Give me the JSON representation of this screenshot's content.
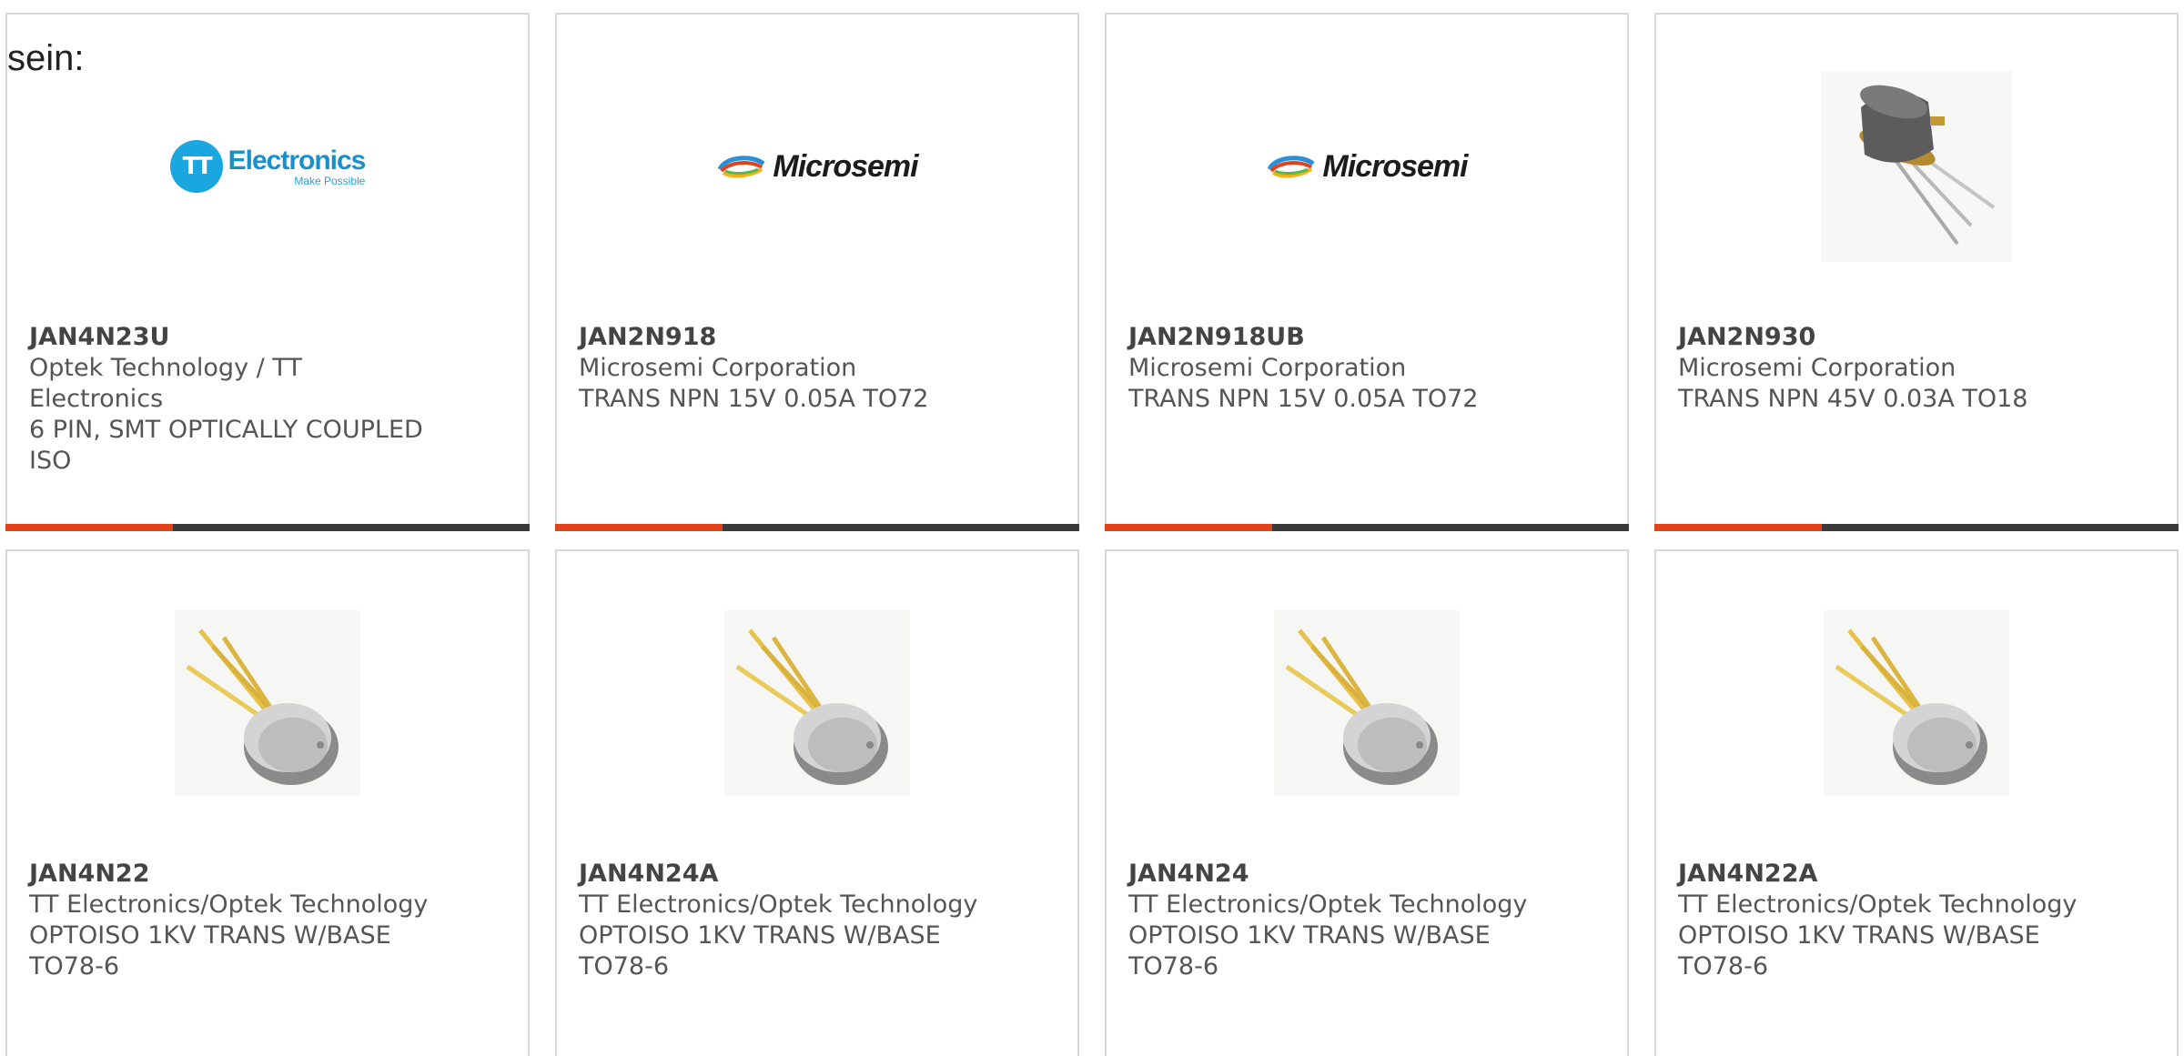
{
  "intro": {
    "text": "sein:"
  },
  "colors": {
    "accent": "#e2431a",
    "bar": "#3a3a3a",
    "border": "#d9d9d9",
    "text": "#555555"
  },
  "products": [
    {
      "part": "JAN4N23U",
      "manufacturer": "Optek Technology / TT Electronics",
      "description": "6 PIN, SMT OPTICALLY COUPLED ISO",
      "image": "tt-electronics-logo"
    },
    {
      "part": "JAN2N918",
      "manufacturer": "Microsemi Corporation",
      "description": "TRANS NPN 15V 0.05A TO72",
      "image": "microsemi-logo"
    },
    {
      "part": "JAN2N918UB",
      "manufacturer": "Microsemi Corporation",
      "description": "TRANS NPN 15V 0.05A TO72",
      "image": "microsemi-logo"
    },
    {
      "part": "JAN2N930",
      "manufacturer": "Microsemi Corporation",
      "description": "TRANS NPN 45V 0.03A TO18",
      "image": "to18-transistor-photo"
    },
    {
      "part": "JAN4N22",
      "manufacturer": "TT Electronics/Optek Technology",
      "description": "OPTOISO 1KV TRANS W/BASE TO78-6",
      "image": "to78-optoisolator-photo"
    },
    {
      "part": "JAN4N24A",
      "manufacturer": "TT Electronics/Optek Technology",
      "description": "OPTOISO 1KV TRANS W/BASE TO78-6",
      "image": "to78-optoisolator-photo"
    },
    {
      "part": "JAN4N24",
      "manufacturer": "TT Electronics/Optek Technology",
      "description": "OPTOISO 1KV TRANS W/BASE TO78-6",
      "image": "to78-optoisolator-photo"
    },
    {
      "part": "JAN4N22A",
      "manufacturer": "TT Electronics/Optek Technology",
      "description": "OPTOISO 1KV TRANS W/BASE TO78-6",
      "image": "to78-optoisolator-photo"
    }
  ],
  "logos": {
    "tt": {
      "mark": "TT",
      "name": "Electronics",
      "tagline": "Make Possible"
    },
    "microsemi": {
      "name": "Microsemi"
    }
  }
}
